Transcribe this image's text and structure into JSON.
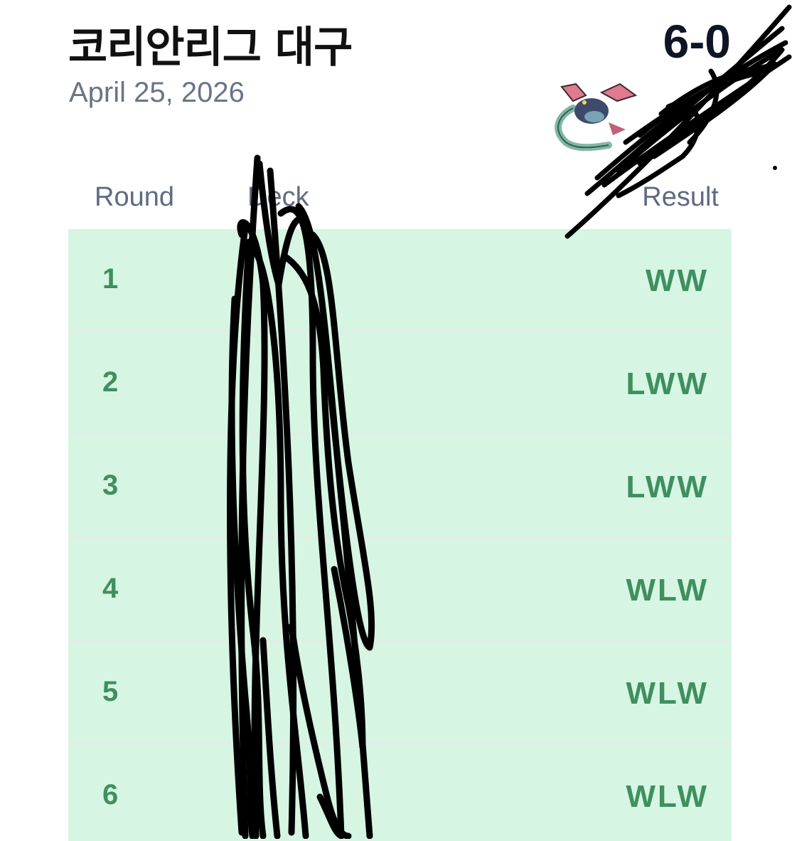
{
  "header": {
    "title": "코리안리그 대구",
    "date": "April 25, 2026",
    "record": "6-0"
  },
  "table": {
    "columns": [
      "Round",
      "Deck",
      "Result"
    ],
    "rows": [
      {
        "round": "1",
        "result": "WW"
      },
      {
        "round": "2",
        "result": "LWW"
      },
      {
        "round": "3",
        "result": "LWW"
      },
      {
        "round": "4",
        "result": "WLW"
      },
      {
        "round": "5",
        "result": "WLW"
      },
      {
        "round": "6",
        "result": "WLW"
      }
    ]
  },
  "colors": {
    "row_background": "#d6f5e3",
    "result_text": "#3f8f5f",
    "header_text": "#5f6a82",
    "title_text": "#111111"
  }
}
